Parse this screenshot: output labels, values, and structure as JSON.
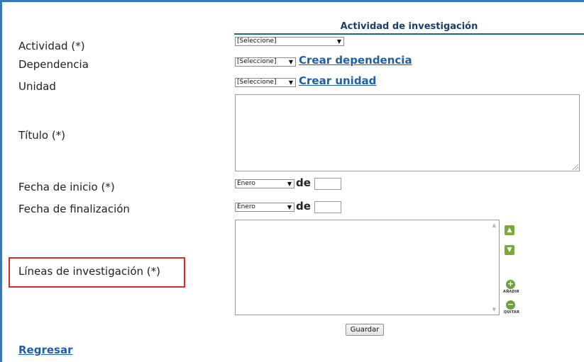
{
  "form": {
    "title": "Actividad de investigación",
    "fields": {
      "actividad": {
        "label": "Actividad (*)",
        "value": "[Seleccione]"
      },
      "dependencia": {
        "label": "Dependencia",
        "value": "[Seleccione]",
        "link": "Crear dependencia"
      },
      "unidad": {
        "label": "Unidad",
        "value": "[Seleccione]",
        "link": "Crear unidad"
      },
      "titulo": {
        "label": "Título (*)"
      },
      "fecha_inicio": {
        "label": "Fecha de inicio (*)",
        "month": "Enero",
        "de": "de"
      },
      "fecha_fin": {
        "label": "Fecha de finalización",
        "month": "Enero",
        "de": "de"
      },
      "lineas": {
        "label": "Líneas de investigación (*)"
      }
    },
    "list_controls": {
      "add": "AÑADIR",
      "remove": "QUITAR"
    },
    "save_label": "Guardar",
    "back_label": "Regresar"
  },
  "colors": {
    "accent": "#1f5fa8",
    "highlight": "#d42a2a",
    "green": "#7aa93a",
    "frame": "#3a78b8"
  }
}
